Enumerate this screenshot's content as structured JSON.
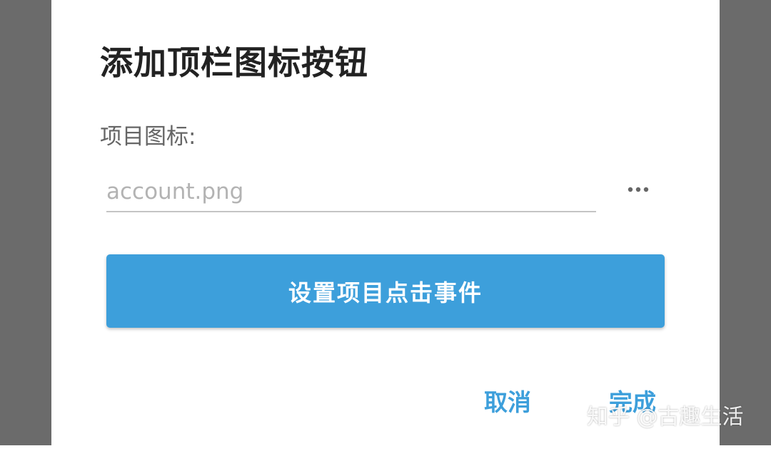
{
  "dialog": {
    "title": "添加顶栏图标按钮",
    "icon_field": {
      "label": "项目图标:",
      "placeholder": "account.png",
      "value": ""
    },
    "more_icon": "more-horizontal-icon",
    "primary_button": "设置项目点击事件",
    "cancel_button": "取消",
    "done_button": "完成"
  },
  "watermark": "知乎 @古趣生活",
  "colors": {
    "accent": "#3d9fdb",
    "backdrop": "#6b6b6b",
    "dialog_bg": "#ffffff",
    "title": "#222222",
    "label": "#666666",
    "placeholder": "#b3b3b3",
    "underline": "#c4c4c4"
  }
}
